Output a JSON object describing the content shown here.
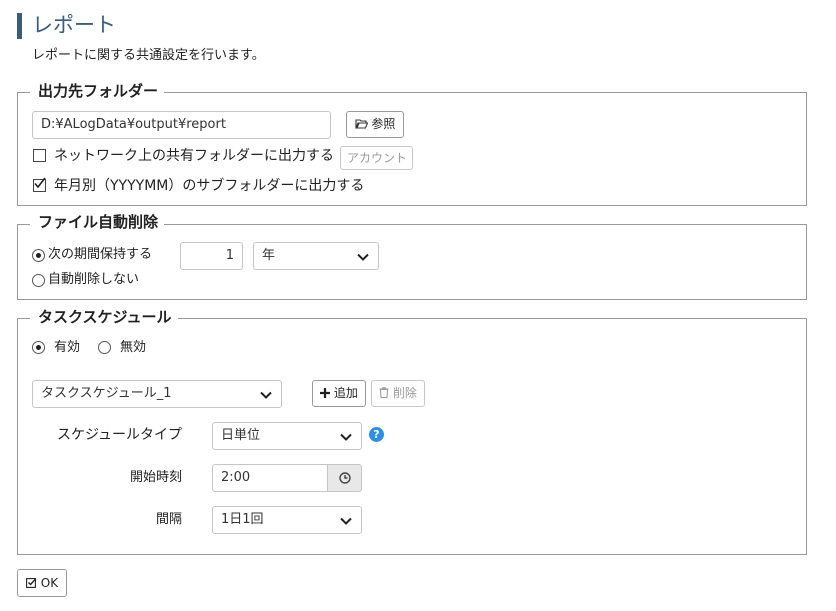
{
  "page": {
    "title": "レポート",
    "subtitle": "レポートに関する共通設定を行います。"
  },
  "output_folder": {
    "legend": "出力先フォルダー",
    "path_value": "D:¥ALogData¥output¥report",
    "browse_label": "参照",
    "network_share_label": "ネットワーク上の共有フォルダーに出力する",
    "network_share_checked": false,
    "account_label": "アカウント",
    "monthly_subfolder_label": "年月別（YYYYMM）のサブフォルダーに出力する",
    "monthly_subfolder_checked": true
  },
  "auto_delete": {
    "legend": "ファイル自動削除",
    "keep_label": "次の期間保持する",
    "keep_selected": true,
    "period_value": "1",
    "unit_value": "年",
    "no_delete_label": "自動削除しない"
  },
  "task_schedule": {
    "legend": "タスクスケジュール",
    "enabled_label": "有効",
    "disabled_label": "無効",
    "enabled": true,
    "schedule_select_value": "タスクスケジュール_1",
    "add_label": "追加",
    "delete_label": "削除",
    "type_label": "スケジュールタイプ",
    "type_value": "日単位",
    "start_label": "開始時刻",
    "start_value": "2:00",
    "interval_label": "間隔",
    "interval_value": "1日1回"
  },
  "footer": {
    "ok_label": "OK"
  },
  "colors": {
    "accent": "#3a5d7c",
    "help": "#2d8fe6",
    "border": "#9a9a9a"
  }
}
